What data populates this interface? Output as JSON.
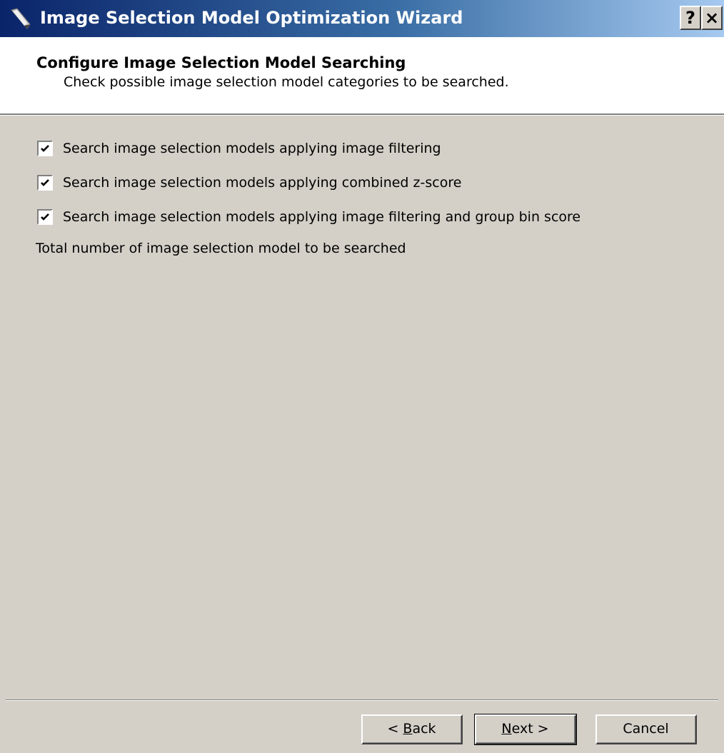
{
  "window": {
    "title": "Image Selection Model Optimization Wizard",
    "help_label": "?",
    "close_label": "×"
  },
  "header": {
    "title": "Configure Image Selection Model Searching",
    "subtitle": "Check possible image selection model categories to be searched."
  },
  "options": [
    {
      "label": "Search image selection models applying image filtering",
      "checked": true
    },
    {
      "label": "Search image selection models applying combined z-score",
      "checked": true
    },
    {
      "label": "Search image selection models applying image filtering and group bin score",
      "checked": true
    }
  ],
  "total_label": "Total number of image selection model to be searched",
  "buttons": {
    "back": {
      "prefix": "< ",
      "accel": "B",
      "rest": "ack"
    },
    "next": {
      "prefix": "",
      "accel": "N",
      "rest": "ext >"
    },
    "cancel": "Cancel"
  },
  "colors": {
    "title_gradient_start": "#0a246a",
    "title_gradient_end": "#a6caf0",
    "dialog_face": "#d4d0c8",
    "header_bg": "#ffffff"
  }
}
